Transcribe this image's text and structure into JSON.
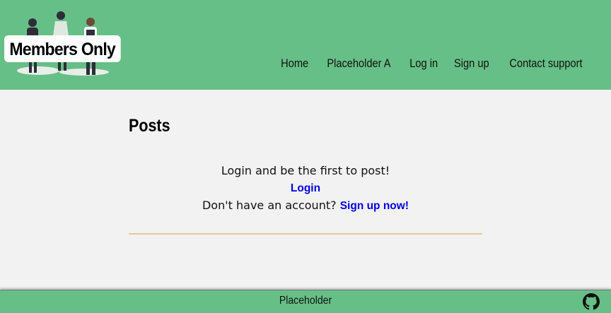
{
  "header": {
    "brand": "Members Only",
    "nav": [
      "Home",
      "Placeholder A",
      "Log in",
      "Sign up",
      "Contact support"
    ]
  },
  "main": {
    "title": "Posts",
    "empty_message": "Login and be the first to post!",
    "login_link": "Login",
    "no_account_text": "Don't have an account?",
    "signup_link": "Sign up now!"
  },
  "footer": {
    "text": "Placeholder",
    "icon": "github-icon"
  },
  "colors": {
    "header_bg": "#66bf86",
    "page_bg": "#f2f2f2",
    "link": "#0000ee",
    "divider": "#e8c88d"
  }
}
